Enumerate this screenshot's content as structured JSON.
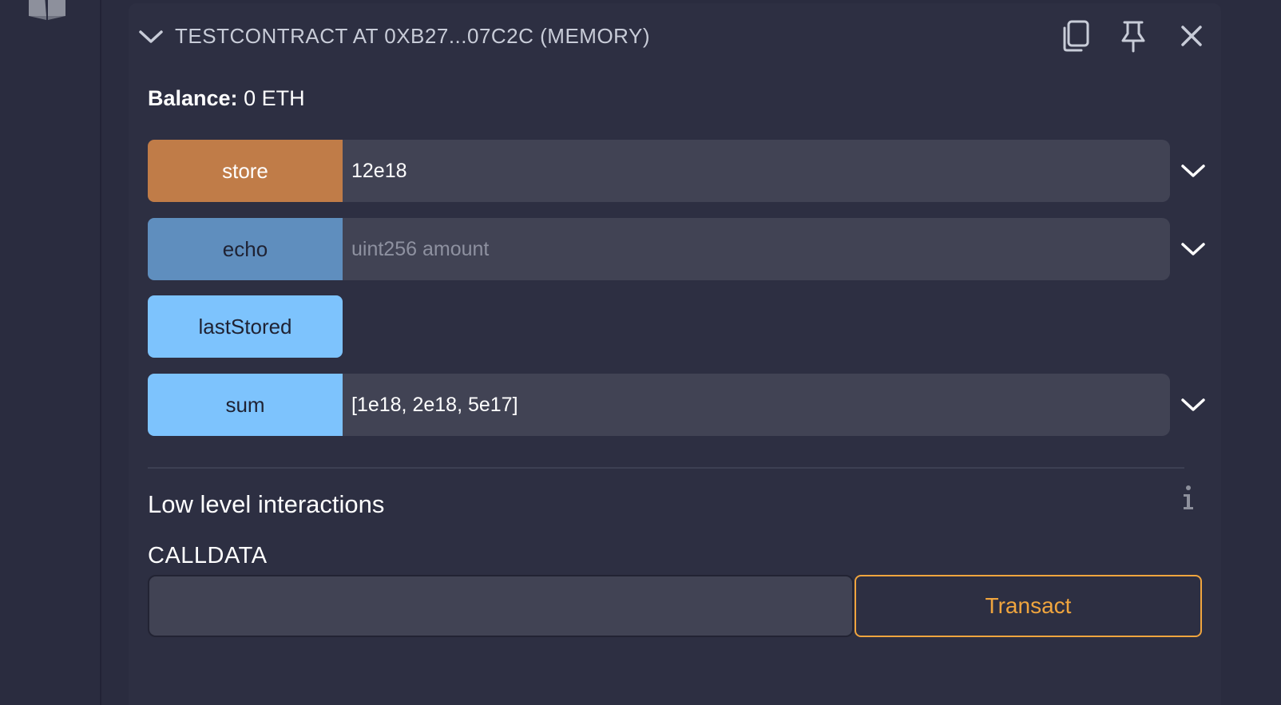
{
  "header": {
    "title": "TESTCONTRACT AT 0XB27...07C2C (MEMORY)"
  },
  "balance": {
    "label": "Balance:",
    "value": "0 ETH"
  },
  "functions": [
    {
      "name": "store",
      "input_value": "12e18",
      "color": "#c07c48",
      "text_color": "#ffffff",
      "has_input": true
    },
    {
      "name": "echo",
      "input_placeholder": "uint256 amount",
      "color": "#5f8ebe",
      "text_color": "#1f2233",
      "has_input": true
    },
    {
      "name": "lastStored",
      "color": "#7dc3fd",
      "text_color": "#1f2233",
      "has_input": false
    },
    {
      "name": "sum",
      "input_value": "[1e18, 2e18, 5e17]",
      "color": "#7dc3fd",
      "text_color": "#1f2233",
      "has_input": true
    }
  ],
  "low_level": {
    "title": "Low level interactions",
    "calldata_label": "CALLDATA",
    "calldata_value": "",
    "transact_label": "Transact"
  },
  "colors": {
    "background": "#2a2c3f",
    "panel": "#2d2f42",
    "input_bg": "#414354",
    "accent_orange": "#f0a53e"
  },
  "icons": {
    "left_rail": "book-icon",
    "collapse": "chevron-down-icon",
    "copy": "copy-icon",
    "pin": "pin-icon",
    "close": "close-icon",
    "expand": "chevron-down-icon",
    "info": "info-icon"
  }
}
